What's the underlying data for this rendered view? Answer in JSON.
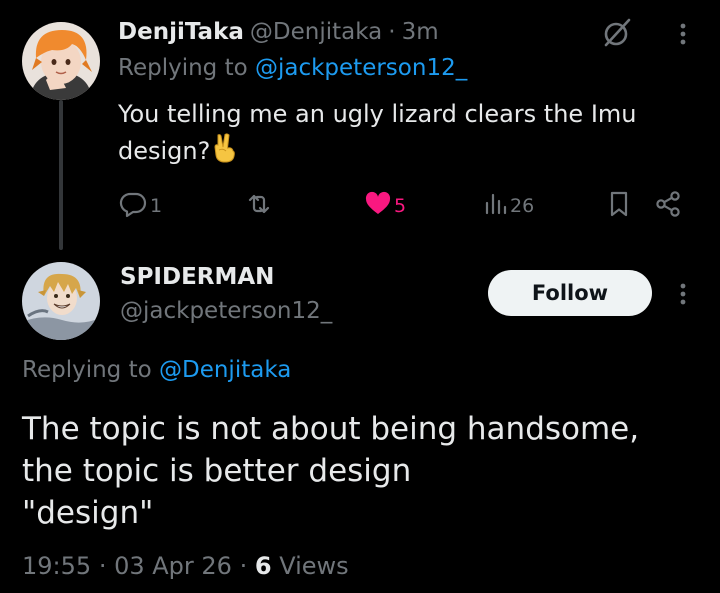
{
  "reply_tweet": {
    "display_name": "DenjiTaka",
    "handle": "@Denjitaka",
    "separator": "·",
    "time": "3m",
    "replying_prefix": "Replying to",
    "replying_to": "@jackpeterson12_",
    "text": "You telling me an ugly lizard clears the Imu design?",
    "emoji": "peace-sign-emoji",
    "actions": {
      "reply_count": "1",
      "retweet_count": "",
      "like_count": "5",
      "views_count": "26"
    },
    "icons": {
      "grok": "grok-icon",
      "more": "more-vertical-icon",
      "reply": "reply-icon",
      "retweet": "retweet-icon",
      "like": "heart-filled-icon",
      "views": "views-chart-icon",
      "bookmark": "bookmark-icon",
      "share": "share-icon"
    },
    "like_color": "#f91880"
  },
  "main_tweet": {
    "display_name": "SPIDERMAN",
    "handle": "@jackpeterson12_",
    "follow_label": "Follow",
    "replying_prefix": "Replying to",
    "replying_to": "@Denjitaka",
    "text_lines": [
      "The topic is not about being handsome,",
      "the topic is better design",
      "\"design\""
    ],
    "meta": {
      "time": "19:55",
      "sep1": "·",
      "date": "03 Apr 26",
      "sep2": "·",
      "views_count": "6",
      "views_label": "Views"
    }
  },
  "colors": {
    "background": "#000000",
    "text_primary": "#e7e9ea",
    "text_secondary": "#71767b",
    "link": "#1d9bf0",
    "follow_bg": "#eff3f4",
    "follow_text": "#0f1419"
  }
}
